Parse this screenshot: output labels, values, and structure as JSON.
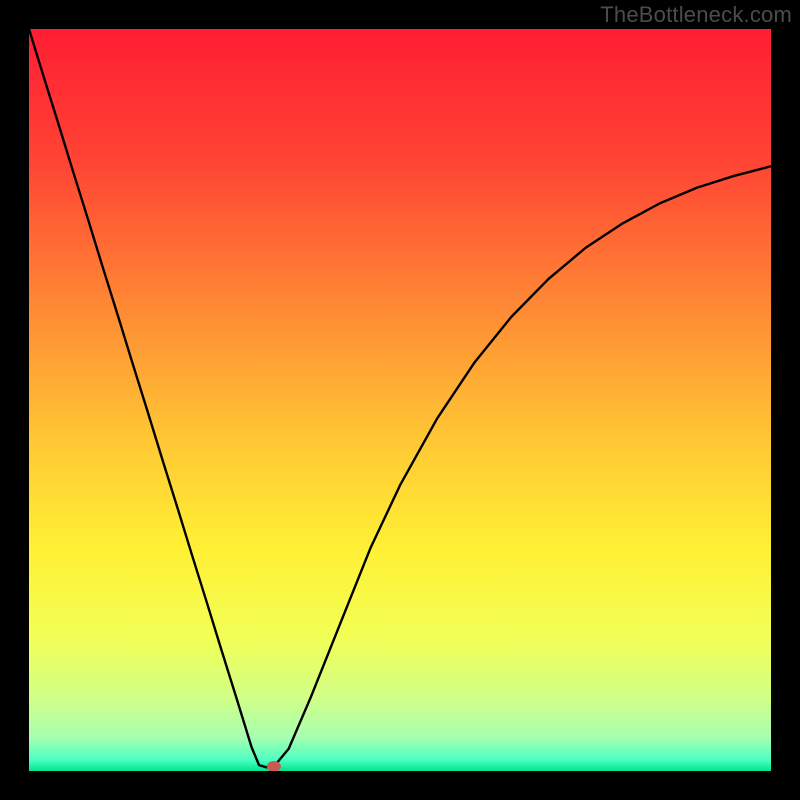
{
  "watermark": "TheBottleneck.com",
  "chart_data": {
    "type": "line",
    "title": "",
    "xlabel": "",
    "ylabel": "",
    "xlim": [
      0,
      100
    ],
    "ylim": [
      0,
      100
    ],
    "x": [
      0,
      2,
      4,
      6,
      8,
      10,
      12,
      14,
      16,
      18,
      20,
      22,
      24,
      26,
      28,
      30,
      31,
      32,
      33,
      35,
      38,
      42,
      46,
      50,
      55,
      60,
      65,
      70,
      75,
      80,
      85,
      90,
      95,
      100
    ],
    "values": [
      100,
      93.5,
      87.1,
      80.6,
      74.2,
      67.7,
      61.3,
      54.8,
      48.4,
      41.9,
      35.5,
      29.0,
      22.6,
      16.1,
      9.7,
      3.2,
      0.8,
      0.5,
      0.6,
      3.0,
      10.0,
      20.0,
      30.0,
      38.5,
      47.5,
      55.0,
      61.2,
      66.3,
      70.5,
      73.8,
      76.5,
      78.6,
      80.2,
      81.5
    ],
    "marker": {
      "x": 33,
      "y": 0.6
    },
    "background_stops": [
      {
        "t": 0.0,
        "color": "#ff1e34"
      },
      {
        "t": 0.18,
        "color": "#ff4434"
      },
      {
        "t": 0.38,
        "color": "#ff8b34"
      },
      {
        "t": 0.55,
        "color": "#ffc634"
      },
      {
        "t": 0.7,
        "color": "#fff034"
      },
      {
        "t": 0.82,
        "color": "#f2ff56"
      },
      {
        "t": 0.9,
        "color": "#d2ff86"
      },
      {
        "t": 0.955,
        "color": "#a6ffb0"
      },
      {
        "t": 0.985,
        "color": "#4cffc2"
      },
      {
        "t": 1.0,
        "color": "#00e48f"
      }
    ]
  }
}
